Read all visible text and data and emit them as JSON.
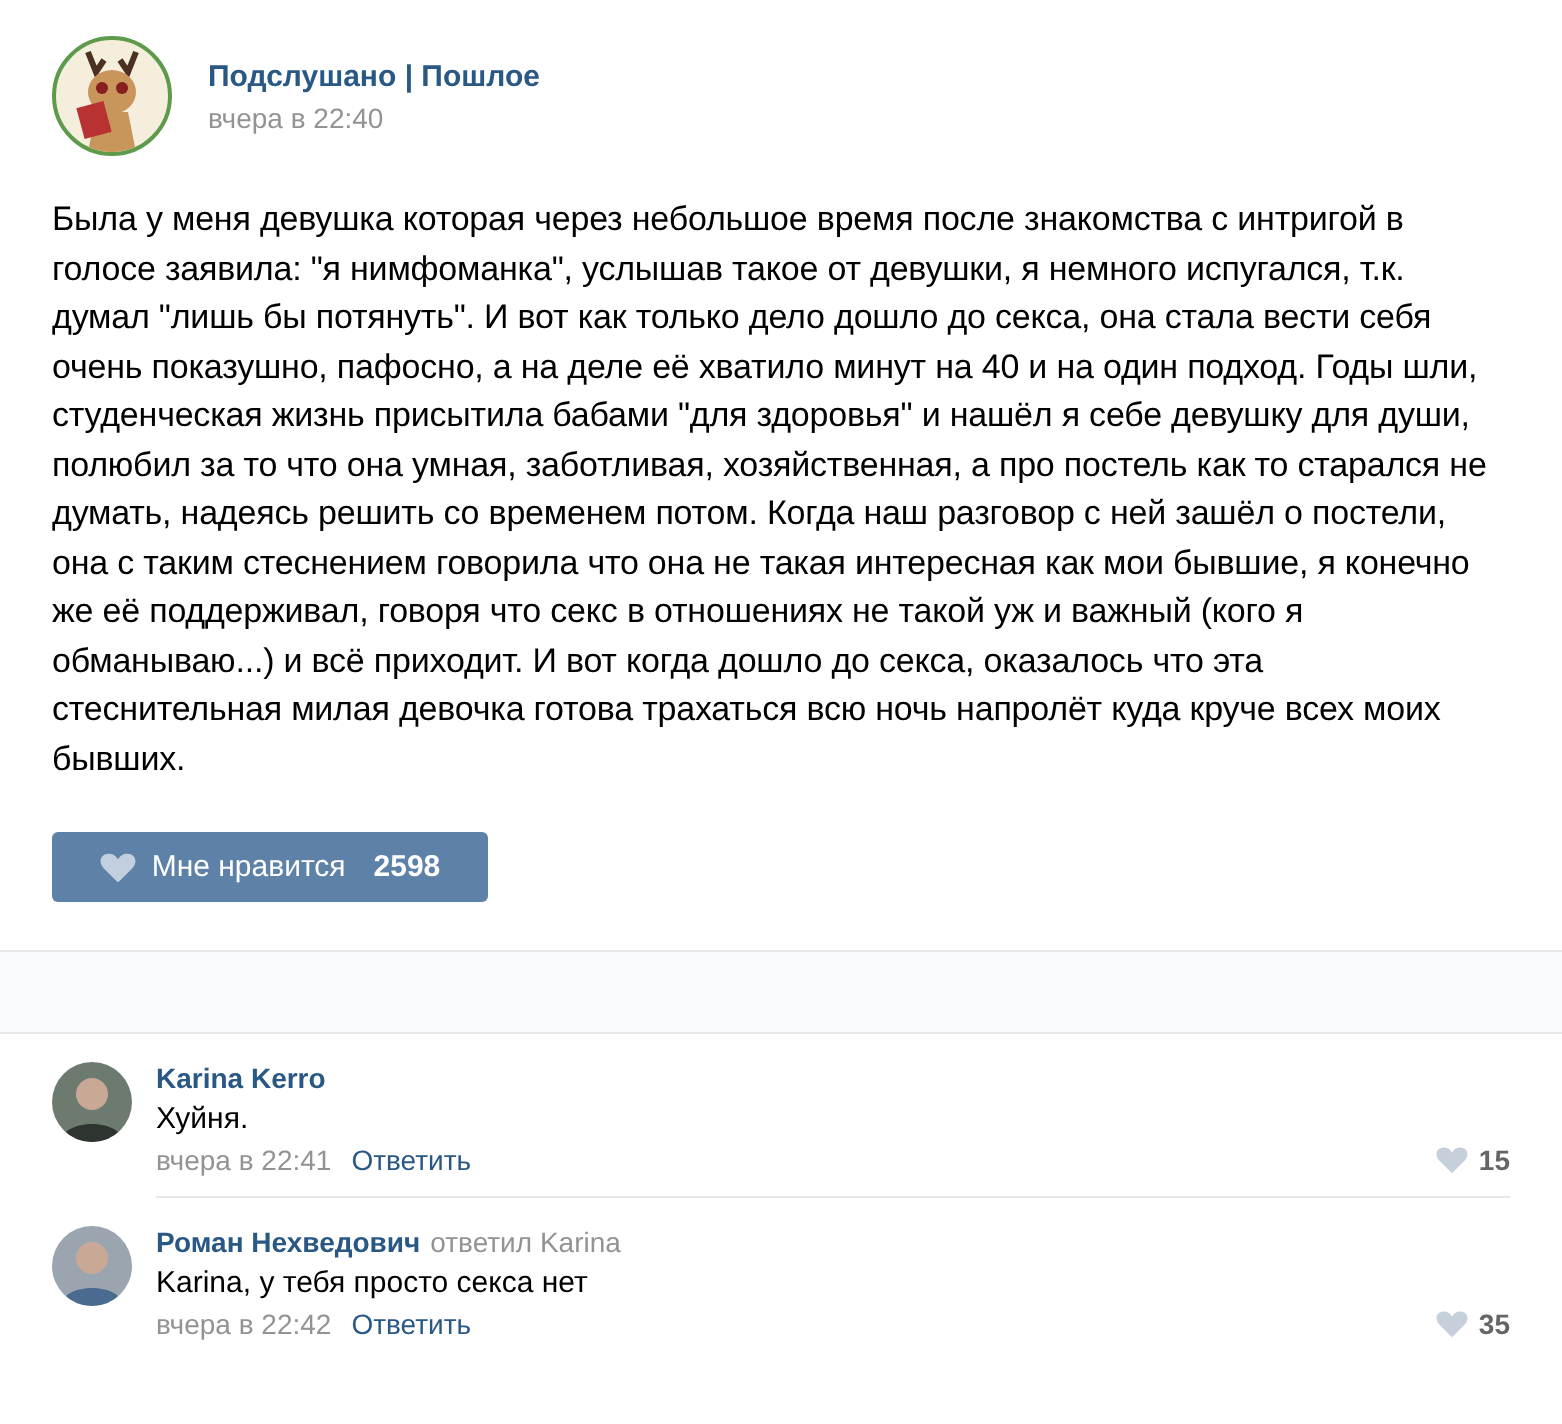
{
  "post": {
    "author": "Подслушано | Пошлое",
    "time": "вчера в 22:40",
    "text": "Была у меня девушка которая через небольшое время после знакомства с интригой в голосе заявила: \"я нимфоманка\", услышав такое от девушки, я немного испугался, т.к. думал \"лишь бы потянуть\". И вот как только дело дошло до секса, она стала вести себя очень показушно, пафосно, а на деле её хватило минут на 40 и на один подход. Годы шли, студенческая жизнь присытила бабами \"для здоровья\" и нашёл я себе девушку для души, полюбил за то что она умная, заботливая, хозяйственная, а про постель как то старался не думать, надеясь решить со временем потом. Когда наш разговор с ней зашёл о постели, она с таким стеснением говорила что она не такая интересная как мои бывшие, я конечно же её поддерживал, говоря что секс в отношениях не такой уж и важный (кого я обманываю...) и всё приходит. И вот когда дошло до секса, оказалось что эта стеснительная милая девочка готова трахаться всю ночь напролёт куда круче всех моих бывших.",
    "like": {
      "label": "Мне нравится",
      "count": "2598"
    }
  },
  "comments": [
    {
      "author": "Karina Kerro",
      "text": "Хуйня.",
      "time": "вчера в 22:41",
      "reply": "Ответить",
      "likes": "15"
    },
    {
      "author": "Роман Нехведович",
      "reply_to": "ответил Karina",
      "text": "Karina, у тебя просто секса нет",
      "time": "вчера в 22:42",
      "reply": "Ответить",
      "likes": "35"
    }
  ]
}
